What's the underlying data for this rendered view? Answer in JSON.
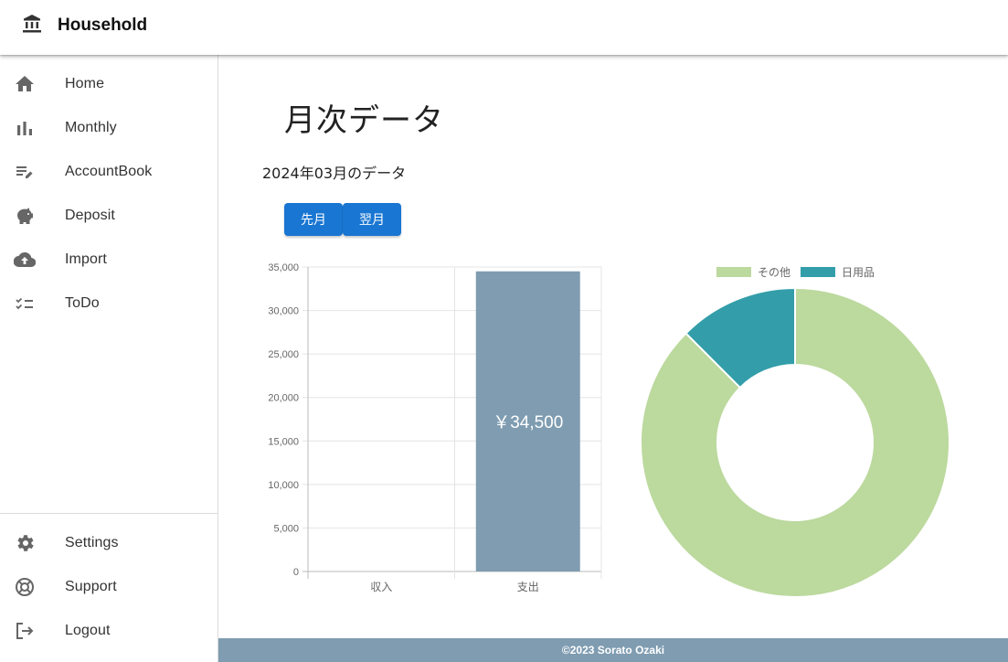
{
  "app": {
    "title": "Household",
    "logo_icon": "bank-icon"
  },
  "sidebar": {
    "items": [
      {
        "label": "Home",
        "icon": "home-icon"
      },
      {
        "label": "Monthly",
        "icon": "bar-chart-icon"
      },
      {
        "label": "AccountBook",
        "icon": "edit-list-icon"
      },
      {
        "label": "Deposit",
        "icon": "piggy-bank-icon"
      },
      {
        "label": "Import",
        "icon": "cloud-upload-icon"
      },
      {
        "label": "ToDo",
        "icon": "checklist-icon"
      }
    ],
    "bottom_items": [
      {
        "label": "Settings",
        "icon": "gear-icon"
      },
      {
        "label": "Support",
        "icon": "lifebuoy-icon"
      },
      {
        "label": "Logout",
        "icon": "logout-icon"
      }
    ]
  },
  "main": {
    "title": "月次データ",
    "subtitle": "2024年03月のデータ",
    "prev_label": "先月",
    "next_label": "翌月"
  },
  "chart_data": [
    {
      "type": "bar",
      "categories": [
        "収入",
        "支出"
      ],
      "values": [
        0,
        34500
      ],
      "data_labels": [
        "",
        "￥34,500"
      ],
      "ylim": [
        0,
        35000
      ],
      "yticks": [
        "0",
        "5,000",
        "10,000",
        "15,000",
        "20,000",
        "25,000",
        "30,000",
        "35,000"
      ],
      "grid": true,
      "bar_color": "#7f9cb1"
    },
    {
      "type": "pie",
      "variant": "doughnut",
      "labels": [
        "その他",
        "日用品"
      ],
      "values": [
        87.5,
        12.5
      ],
      "colors": [
        "#bcd99e",
        "#339ea9"
      ],
      "legend": "top"
    }
  ],
  "footer": {
    "text": "©2023 Sorato Ozaki"
  },
  "colors": {
    "primary": "#1976d2",
    "footer_bg": "#7f9cb1"
  }
}
